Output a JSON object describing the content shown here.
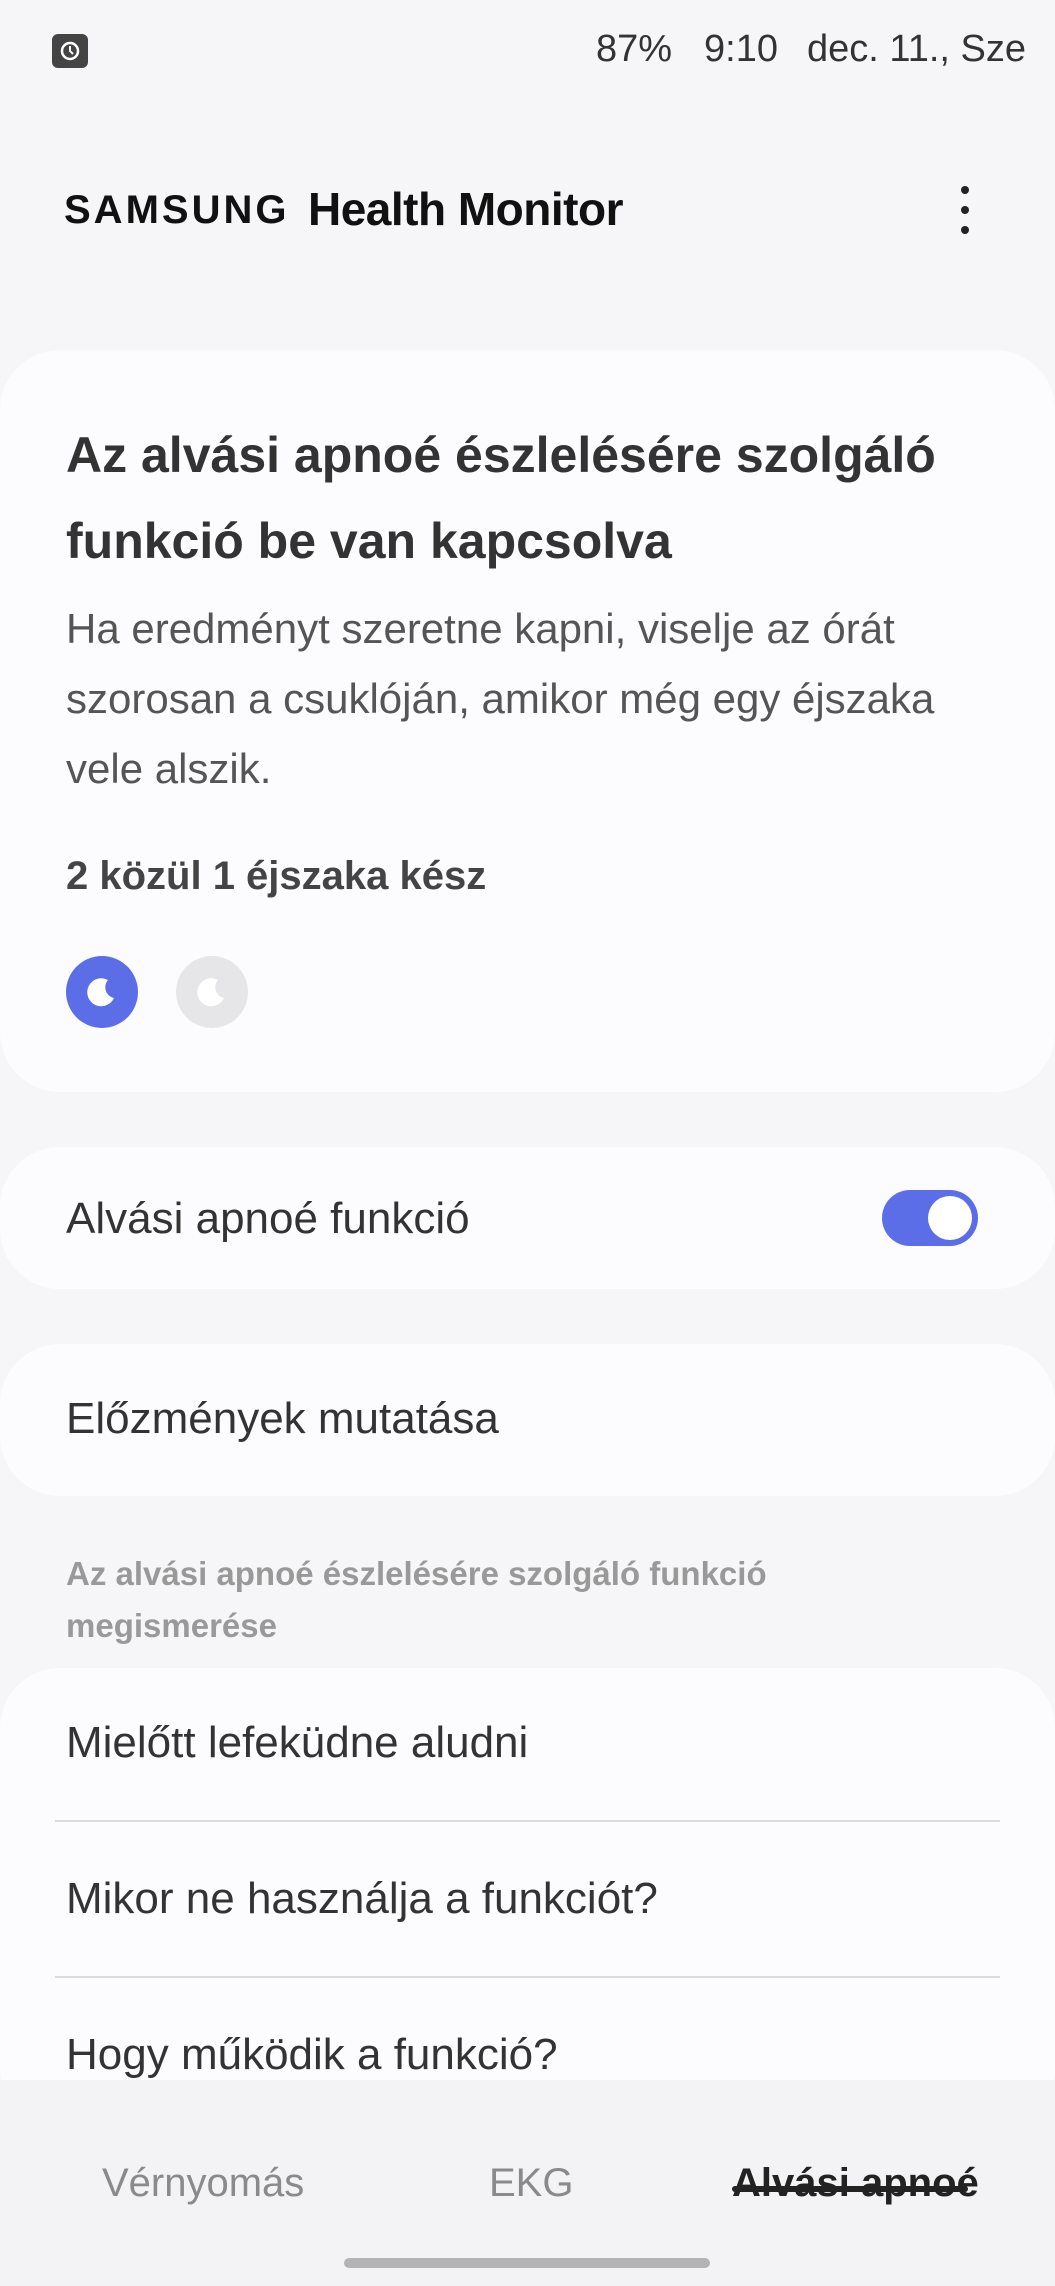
{
  "status_bar": {
    "battery": "87%",
    "time": "9:10",
    "date": "dec. 11., Sze"
  },
  "header": {
    "brand": "SAMSUNG",
    "product": "Health Monitor",
    "more_icon": "more-vert-icon"
  },
  "status_card": {
    "title": "Az alvási apnoé észlelésére szolgáló funkció be van kapcsolva",
    "description": "Ha eredményt szeretne kapni, viselje az órát szorosan a csuklóján, amikor még egy éjszaka vele alszik.",
    "progress_label": "2 közül 1 éjszaka kész",
    "nights_done": 1,
    "nights_total": 2,
    "night_icon": "moon-icon",
    "accent_color": "#5b6ee8"
  },
  "toggle_row": {
    "label": "Alvási apnoé funkció",
    "enabled": true
  },
  "history_row": {
    "label": "Előzmények mutatása"
  },
  "learn_section": {
    "header": "Az alvási apnoé észlelésére szolgáló funkció megismerése",
    "items": [
      {
        "label": "Mielőtt lefeküdne aludni"
      },
      {
        "label": "Mikor ne használja a funkciót?"
      },
      {
        "label": "Hogy működik a funkció?"
      }
    ]
  },
  "bottom_nav": {
    "tabs": [
      {
        "label": "Vérnyomás"
      },
      {
        "label": "EKG"
      },
      {
        "label": "Alvási apnoé"
      }
    ],
    "active_tab": "Alvási apnoé"
  }
}
